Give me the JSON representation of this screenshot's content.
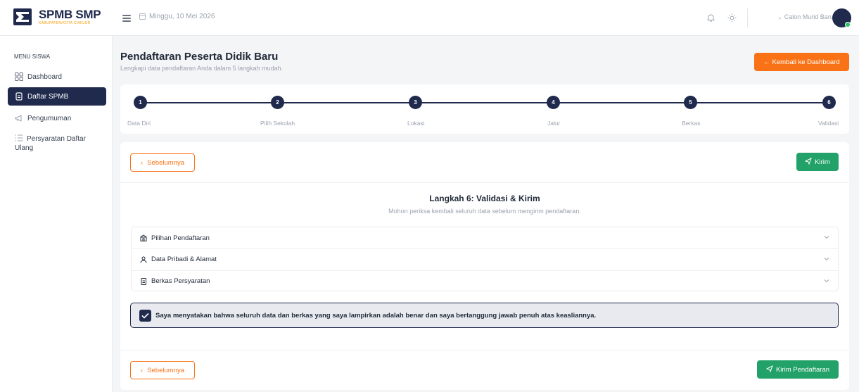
{
  "app": {
    "title": "SPMB SMP",
    "subtitle": "KABUPATEN/KOTA CIANJUR"
  },
  "header": {
    "date": "Minggu, 10 Mei 2026",
    "user_name": "Calon Murid Baru"
  },
  "sidebar": {
    "section_label": "MENU SISWA",
    "items": [
      {
        "label": "Dashboard",
        "icon": "grid-icon"
      },
      {
        "label": "Daftar SPMB",
        "icon": "document-icon",
        "active": true
      },
      {
        "label": "Pengumuman",
        "icon": "megaphone-icon"
      },
      {
        "label": "Persyaratan Daftar Ulang",
        "icon": "list-check-icon"
      }
    ]
  },
  "page": {
    "title": "Pendaftaran Peserta Didik Baru",
    "subtitle": "Lengkapi data pendaftaran Anda dalam 5 langkah mudah.",
    "back_button": "← Kembali ke Dashboard"
  },
  "steps": [
    {
      "number": "1",
      "label": "Data Diri"
    },
    {
      "number": "2",
      "label": "Pilih Sekolah"
    },
    {
      "number": "3",
      "label": "Lokasi"
    },
    {
      "number": "4",
      "label": "Jalur"
    },
    {
      "number": "5",
      "label": "Berkas"
    },
    {
      "number": "6",
      "label": "Validasi"
    }
  ],
  "form": {
    "prev_button": "Sebelumnya",
    "send_button": "Kirim",
    "step_title": "Langkah 6: Validasi & Kirim",
    "step_desc": "Mohon periksa kembali seluruh data sebelum mengirim pendaftaran.",
    "sections": [
      {
        "label": "Pilihan Pendaftaran",
        "icon": "school-icon"
      },
      {
        "label": "Data Pribadi & Alamat",
        "icon": "user-icon"
      },
      {
        "label": "Berkas Persyaratan",
        "icon": "file-icon"
      }
    ],
    "agreement": "Saya menyatakan bahwa seluruh data dan berkas yang saya lampirkan adalah benar dan saya bertanggung jawab penuh atas keasliannya.",
    "agreement_checked": true,
    "submit_button": "Kirim Pendaftaran"
  },
  "colors": {
    "primary": "#1f2a4d",
    "accent": "#f97316",
    "success": "#22a168"
  }
}
